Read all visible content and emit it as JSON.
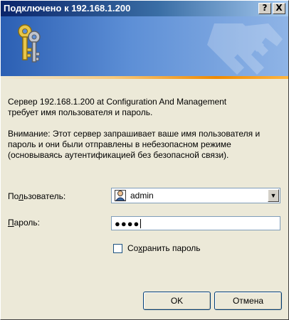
{
  "dialog": {
    "title": "Подключено к 192.168.1.200",
    "help_button": "?",
    "close_button": "X"
  },
  "message": {
    "line1": "Сервер 192.168.1.200 at Configuration And Management",
    "line2": "требует имя пользователя и пароль.",
    "warning": "Внимание: Этот сервер запрашивает ваше имя пользователя и пароль и они были отправлены в небезопасном режиме (основываясь аутентификацией без безопасной связи)."
  },
  "form": {
    "username_label_pre": "По",
    "username_label_key": "л",
    "username_label_post": "ьзователь:",
    "username_value": "admin",
    "password_label_key": "П",
    "password_label_post": "ароль:",
    "password_value": "●●●●",
    "remember_pre": "Со",
    "remember_key": "х",
    "remember_post": "ранить пароль",
    "remember_checked": false
  },
  "buttons": {
    "ok": "OK",
    "cancel": "Отмена"
  },
  "icons": {
    "banner": "keys-icon",
    "user": "user-icon",
    "dropdown": "dropdown-arrow-icon"
  }
}
